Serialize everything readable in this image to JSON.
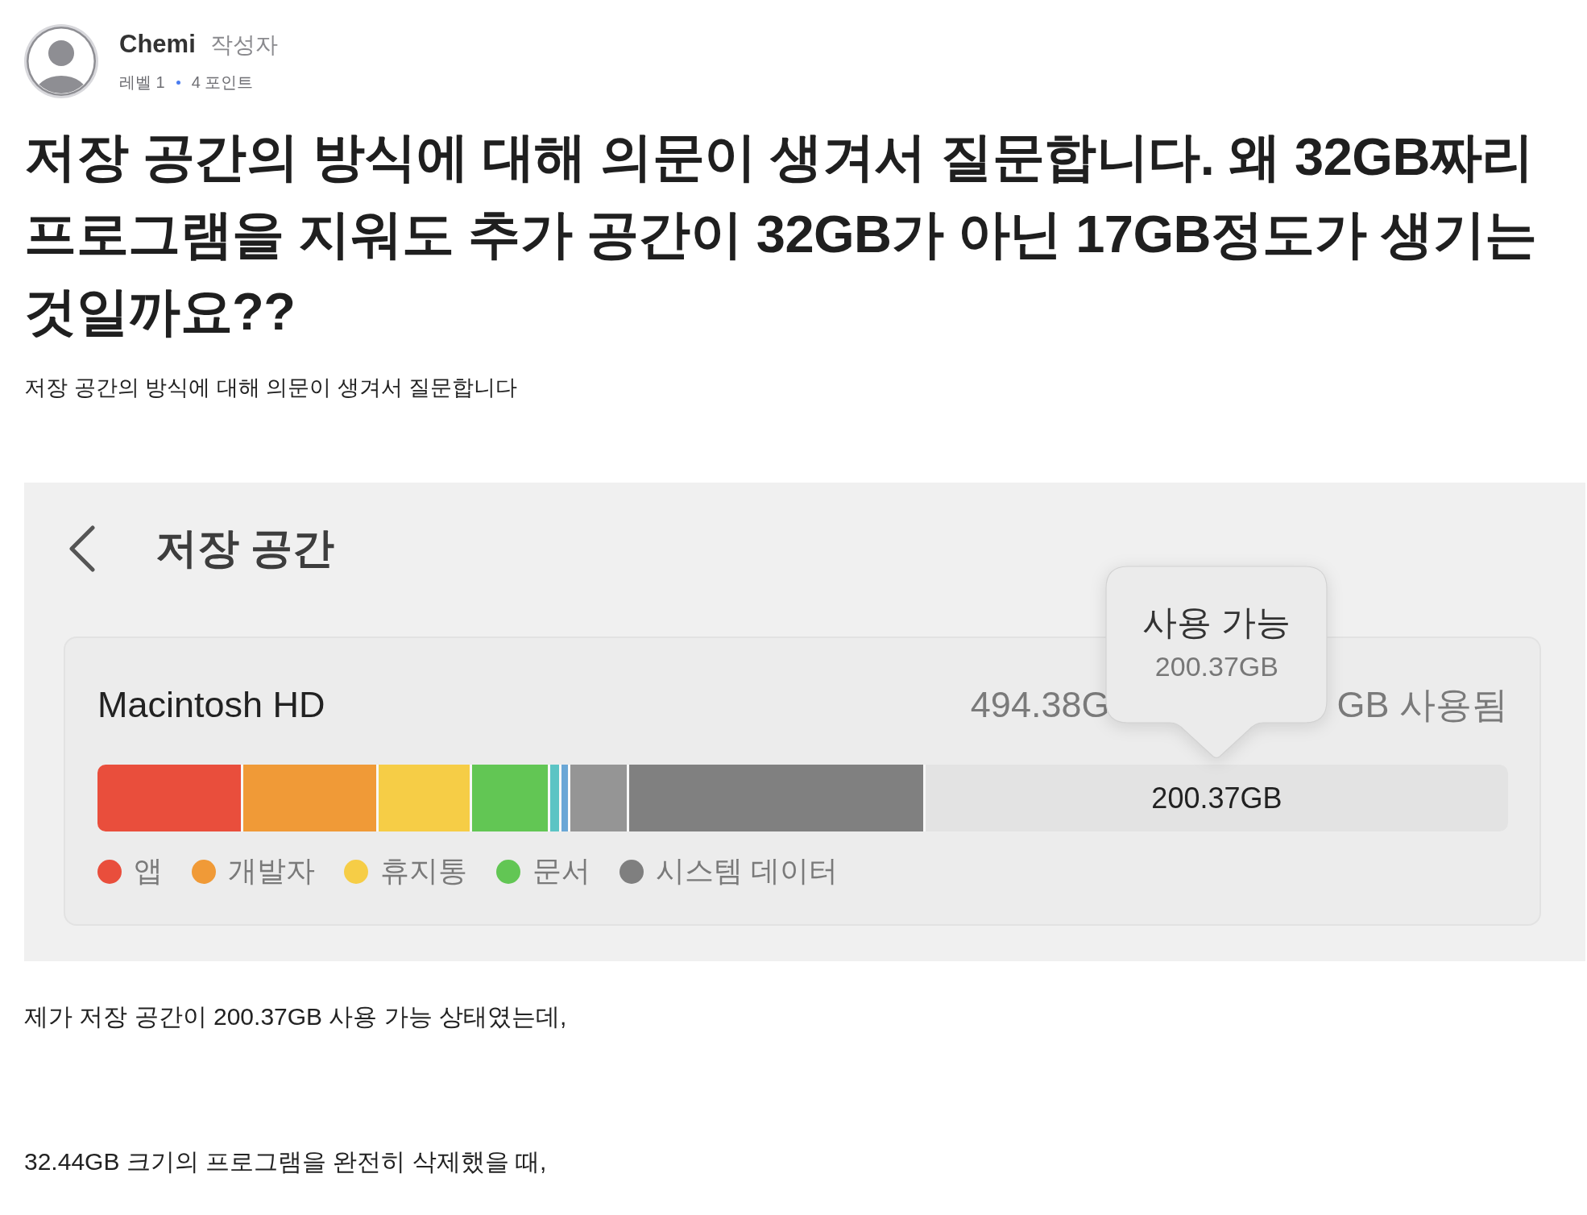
{
  "author": {
    "name": "Chemi",
    "role": "작성자",
    "level": "레벨 1",
    "points": "4 포인트"
  },
  "post": {
    "title": "저장 공간의 방식에 대해 의문이 생겨서 질문합니다. 왜 32GB짜리 프로그램을 지워도 추가 공간이 32GB가 아닌 17GB정도가 생기는 것일까요??",
    "summary": "저장 공간의 방식에 대해 의문이 생겨서 질문합니다",
    "screenshot": {
      "title": "저장 공간",
      "disk_name": "Macintosh HD",
      "total_text": "494.38G",
      "used_text": "GB 사용됨",
      "tooltip": {
        "title": "사용 가능",
        "value": "200.37GB"
      },
      "free_space": {
        "level": 0.413,
        "label": "200.37GB"
      },
      "legend": [
        {
          "label": "앱",
          "color": "#e94e3c"
        },
        {
          "label": "개발자",
          "color": "#f09a37"
        },
        {
          "label": "휴지통",
          "color": "#f6cd46"
        },
        {
          "label": "문서",
          "color": "#62c654"
        },
        {
          "label": "시스템 데이터",
          "color": "#7f7f7f"
        }
      ]
    },
    "paragraphs": [
      "제가 저장 공간이 200.37GB 사용 가능 상태였는데,",
      "32.44GB 크기의 프로그램을 완전히 삭제했을 때,"
    ]
  }
}
